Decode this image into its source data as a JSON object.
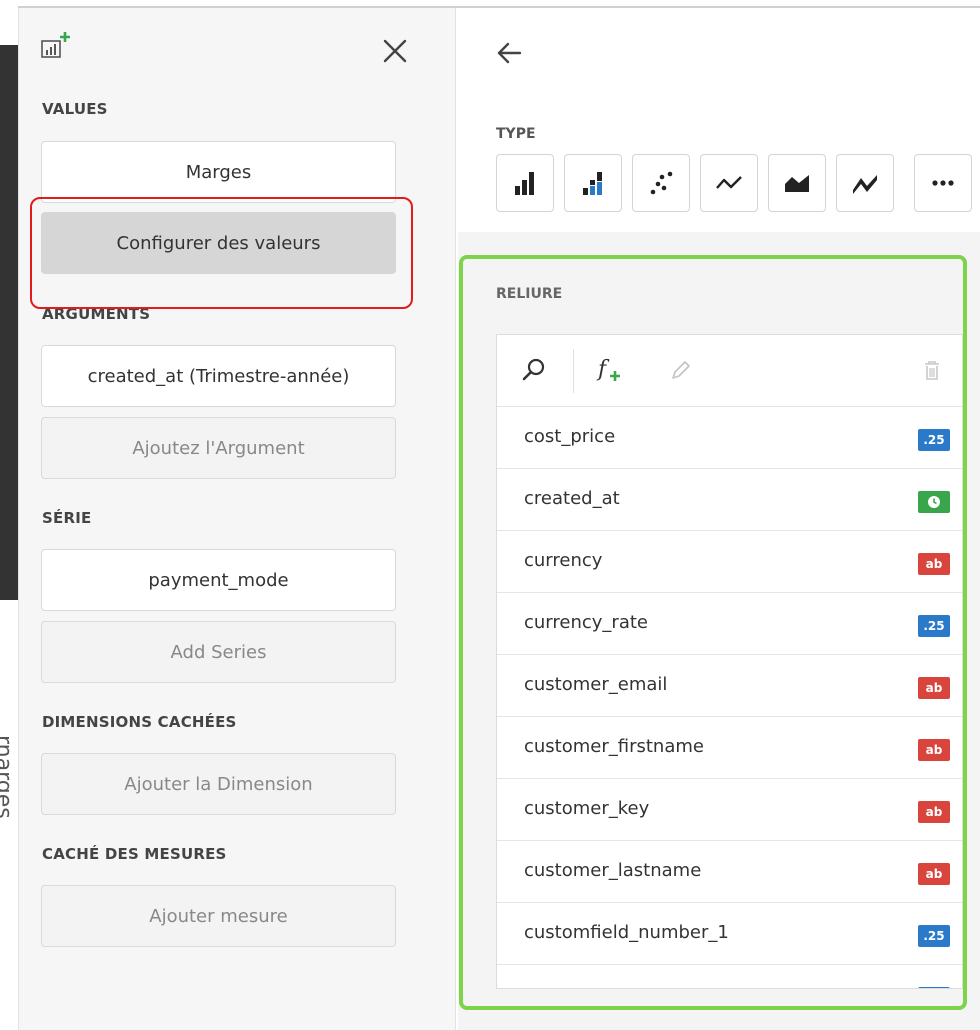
{
  "background": {
    "partial_text": "rnarges"
  },
  "left_panel": {
    "sections": {
      "values": "VALUES",
      "arguments": "ARGUMENTS",
      "series": "SÉRIE",
      "hidden_dimensions": "DIMENSIONS CACHÉES",
      "hidden_measures": "CACHÉ DES MESURES"
    },
    "values_item": "Marges",
    "configure_values": "Configurer des valeurs",
    "argument_item": "created_at (Trimestre-année)",
    "add_argument": "Ajoutez l'Argument",
    "series_item": "payment_mode",
    "add_series": "Add Series",
    "add_dimension": "Ajouter la Dimension",
    "add_measure": "Ajouter mesure"
  },
  "right_panel": {
    "type_label": "TYPE",
    "binding_label": "RELIURE",
    "chart_types": [
      "bar-chart-icon",
      "stacked-bar-chart-icon",
      "scatter-chart-icon",
      "line-chart-icon",
      "area-chart-icon",
      "stacked-line-chart-icon",
      "more-icon"
    ],
    "fields": [
      {
        "name": "cost_price",
        "badge": ".25",
        "kind": "num"
      },
      {
        "name": "created_at",
        "badge": "",
        "kind": "date"
      },
      {
        "name": "currency",
        "badge": "ab",
        "kind": "str"
      },
      {
        "name": "currency_rate",
        "badge": ".25",
        "kind": "num"
      },
      {
        "name": "customer_email",
        "badge": "ab",
        "kind": "str"
      },
      {
        "name": "customer_firstname",
        "badge": "ab",
        "kind": "str"
      },
      {
        "name": "customer_key",
        "badge": "ab",
        "kind": "str"
      },
      {
        "name": "customer_lastname",
        "badge": "ab",
        "kind": "str"
      },
      {
        "name": "customfield_number_1",
        "badge": ".25",
        "kind": "num"
      }
    ]
  },
  "colors": {
    "highlight_red": "#e21b1b",
    "highlight_green": "#7dd34a",
    "badge_number": "#2b7ac9",
    "badge_string": "#d9453d",
    "badge_date": "#3aa64c",
    "accent_add": "#3aa64c"
  }
}
